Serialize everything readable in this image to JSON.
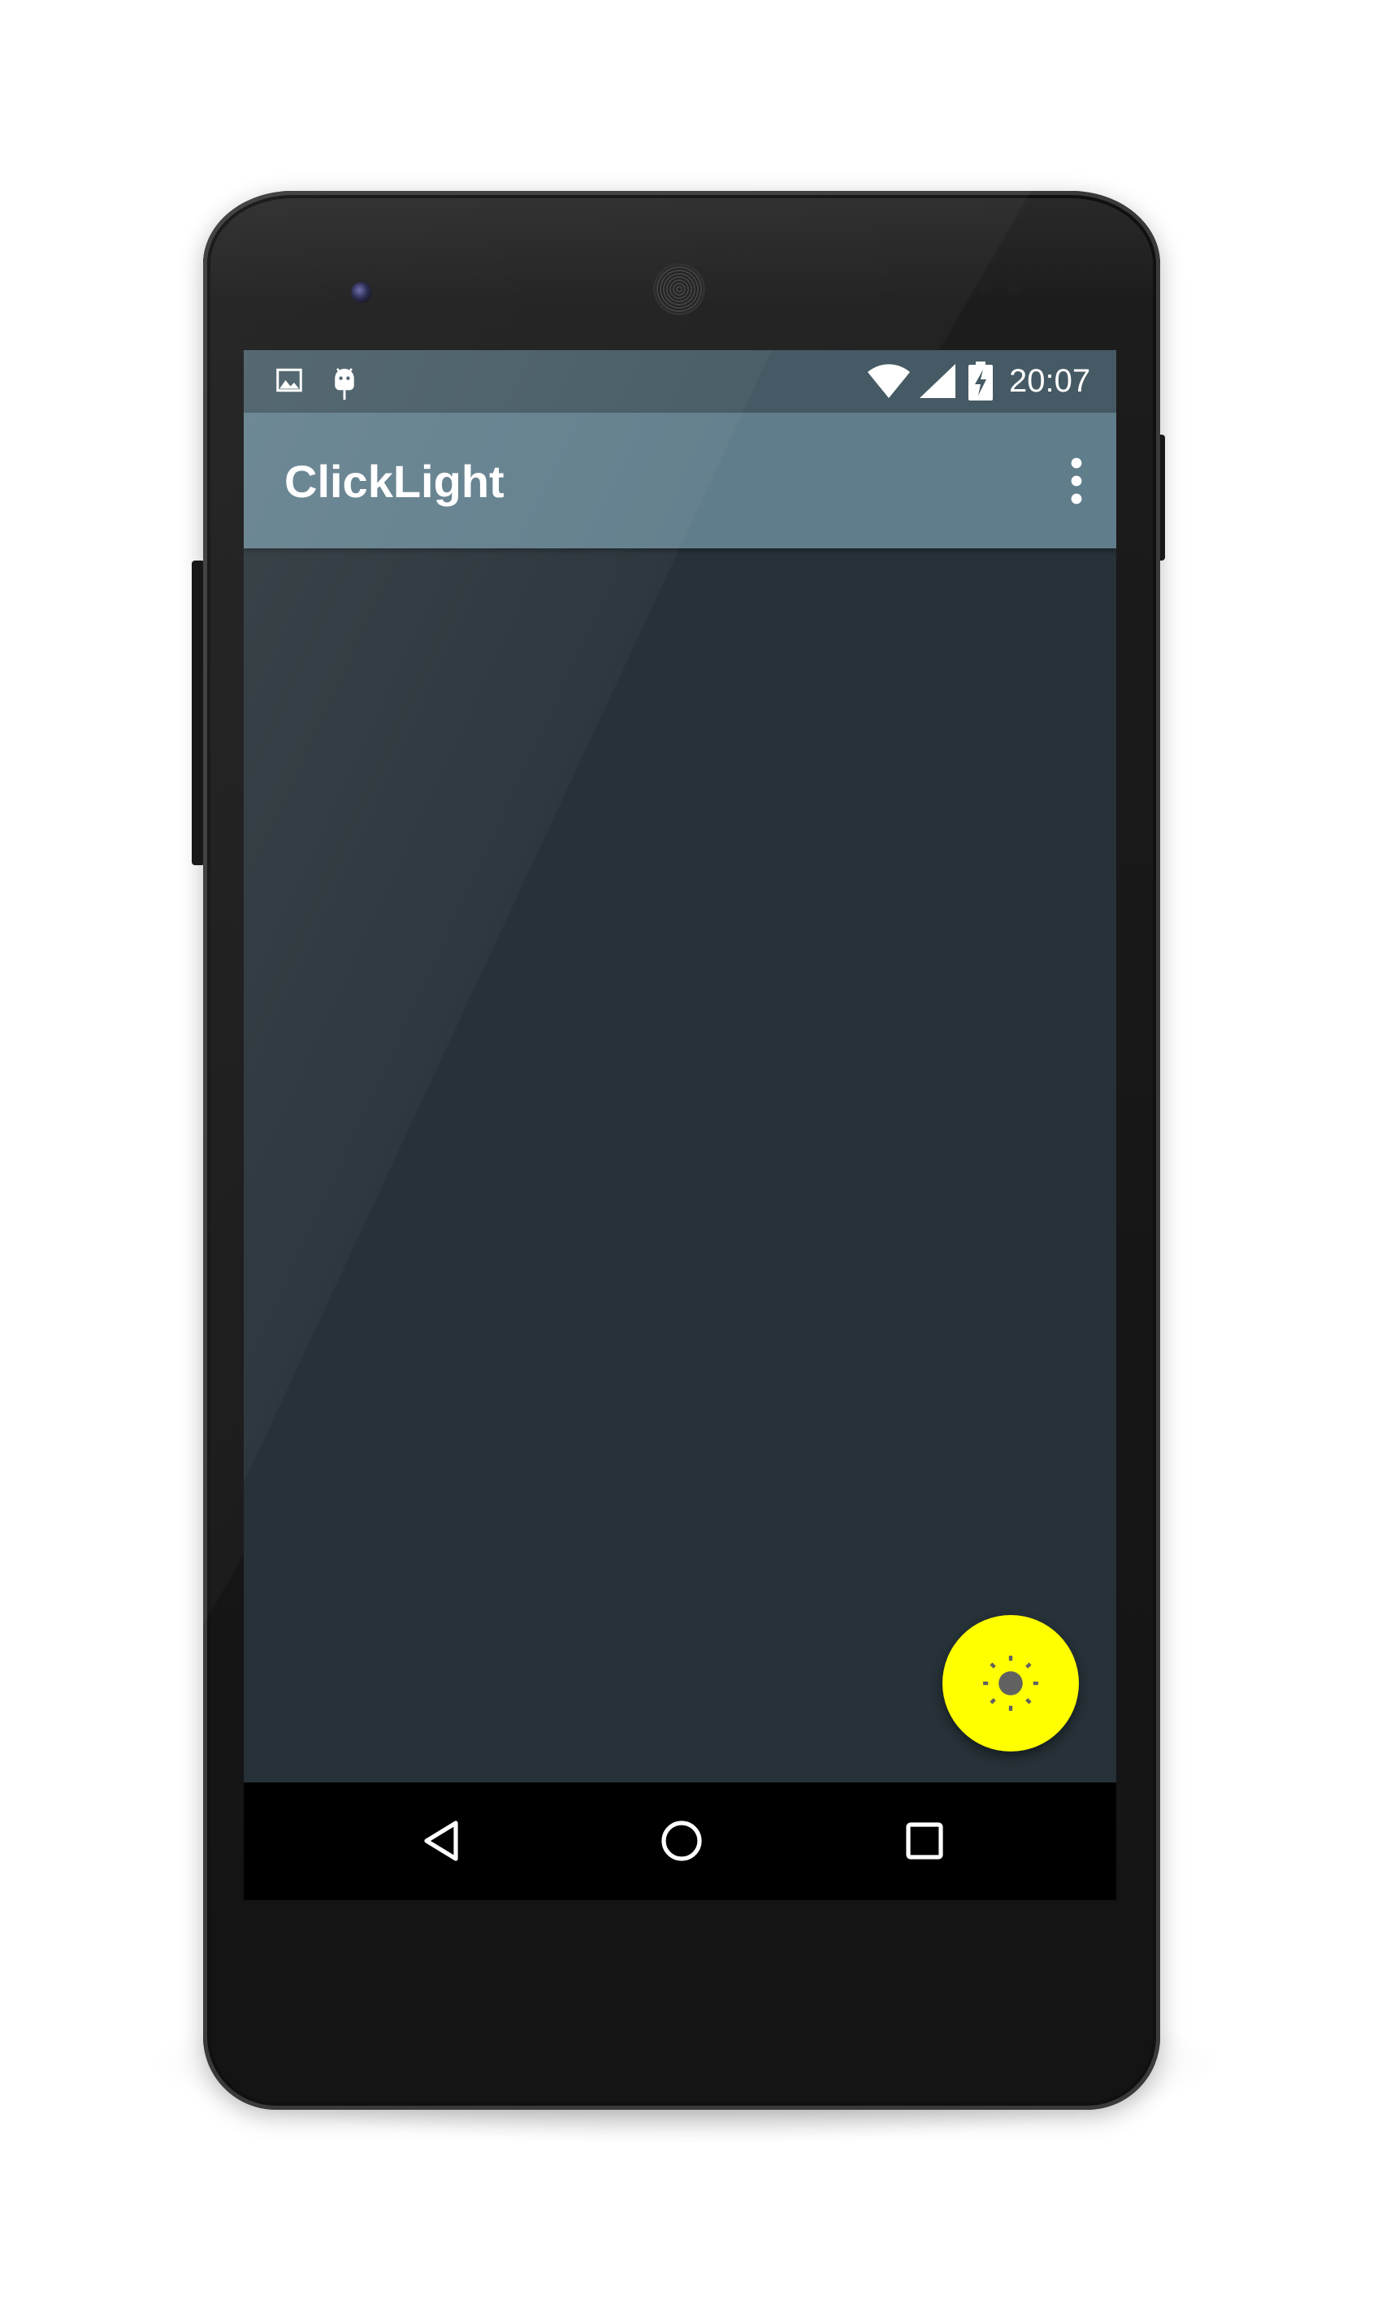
{
  "device": {
    "model_frame": "android-phone"
  },
  "status_bar": {
    "time": "20:07",
    "icons": [
      "image-notification-icon",
      "android-debug-icon",
      "wifi-icon",
      "cell-signal-icon",
      "battery-charging-icon"
    ],
    "color": "#455a64"
  },
  "app_bar": {
    "title": "ClickLight",
    "color": "#607d8b",
    "overflow_icon": "more-vert-icon"
  },
  "content": {
    "background_color": "#263238"
  },
  "fab": {
    "icon": "brightness-icon",
    "color": "#ffff00"
  },
  "nav_bar": {
    "buttons": [
      "back-icon",
      "home-icon",
      "recents-icon"
    ]
  }
}
